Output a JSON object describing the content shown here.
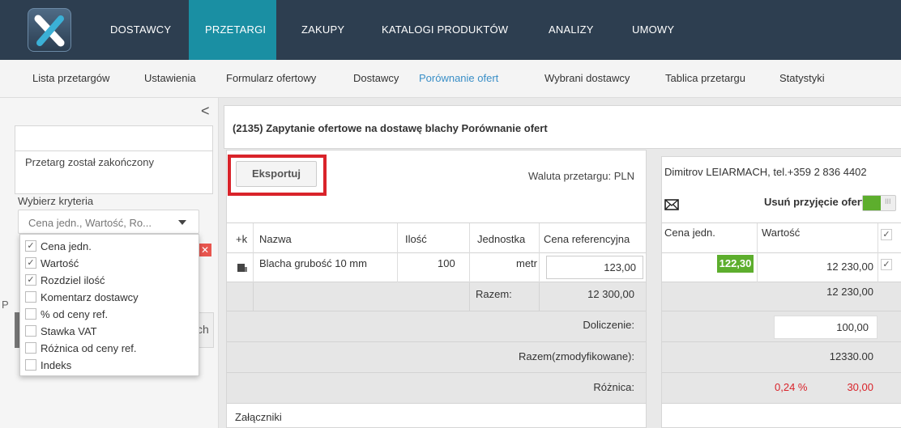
{
  "topnav": {
    "items": [
      "DOSTAWCY",
      "PRZETARGI",
      "ZAKUPY",
      "KATALOGI PRODUKTÓW",
      "ANALIZY",
      "UMOWY"
    ]
  },
  "subnav": {
    "items": [
      "Lista przetargów",
      "Ustawienia",
      "Formularz ofertowy",
      "Dostawcy",
      "Porównanie ofert",
      "Wybrani dostawcy",
      "Tablica przetargu",
      "Statystyki"
    ]
  },
  "sidebar": {
    "collapse_glyph": "<",
    "status": "Przetarg został zakończony",
    "criteria_label": "Wybierz kryteria",
    "criteria_value": "Cena jedn., Wartość, Ro...",
    "options": [
      {
        "label": "Cena jedn.",
        "checked": true
      },
      {
        "label": "Wartość",
        "checked": true
      },
      {
        "label": "Rozdziel ilość",
        "checked": true
      },
      {
        "label": "Komentarz dostawcy",
        "checked": false
      },
      {
        "label": "% od ceny ref.",
        "checked": false
      },
      {
        "label": "Stawka VAT",
        "checked": false
      },
      {
        "label": "Różnica od ceny ref.",
        "checked": false
      },
      {
        "label": "Indeks",
        "checked": false
      }
    ],
    "partial_p": "P",
    "partial_ch": "ch"
  },
  "main": {
    "title": "(2135) Zapytanie ofertowe na dostawę blachy Porównanie ofert",
    "export_label": "Eksportuj",
    "currency_label": "Waluta przetargu: PLN",
    "table": {
      "headers": [
        "+k",
        "Nazwa",
        "Ilość",
        "Jednostka",
        "Cena referencyjna"
      ],
      "row": {
        "name": "Blacha grubość 10 mm",
        "qty": "100",
        "unit": "metr",
        "ref_price": "123,00"
      },
      "sum_label": "Razem:",
      "sum_value": "12 300,00",
      "adjust_label": "Doliczenie:",
      "modified_label": "Razem(zmodyfikowane):",
      "diff_label": "Różnica:"
    },
    "attachments": "Załączniki",
    "supplier": {
      "name": "Dimitrov LEIARMACH, tel.+359 2 836 4402",
      "remove_label": "Usuń przyjęcie oferty",
      "headers": [
        "Cena jedn.",
        "Wartość"
      ],
      "unit_price": "122,30",
      "value": "12 230,00",
      "sum": "12 230,00",
      "adjust": "100,00",
      "modified_sum": "12330.00",
      "diff_percent": "0,24 %",
      "diff_value": "30,00",
      "accent": "#5dae2d",
      "diff_color": "#d9232a"
    }
  }
}
